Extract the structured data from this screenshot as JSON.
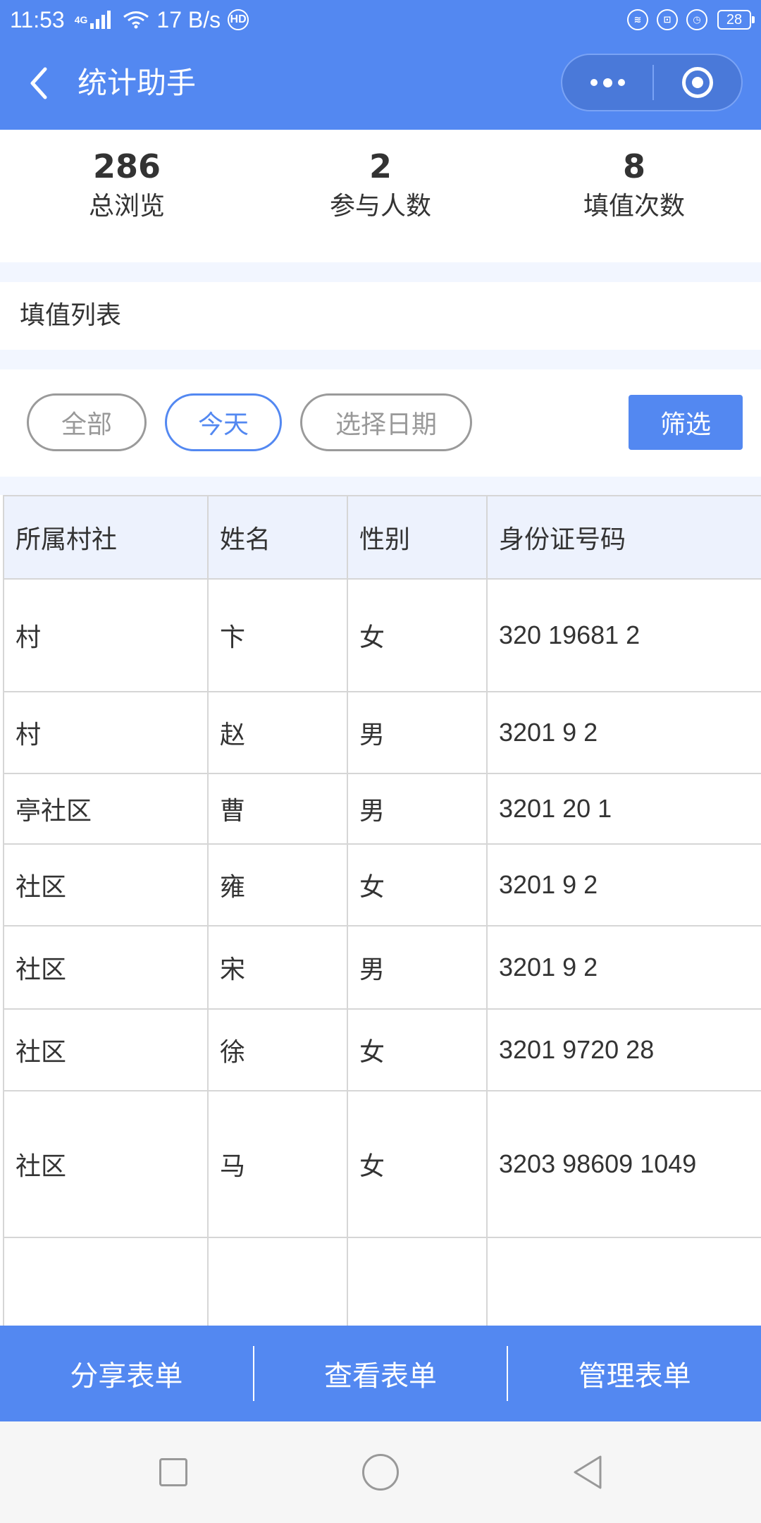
{
  "status_bar": {
    "time": "11:53",
    "net_top": "4G",
    "net_bottom": "ıl",
    "speed": "17 B/s",
    "hd": "HD",
    "battery": "28"
  },
  "nav": {
    "title": "统计助手"
  },
  "stats": [
    {
      "value": "286",
      "label": "总浏览"
    },
    {
      "value": "2",
      "label": "参与人数"
    },
    {
      "value": "8",
      "label": "填值次数"
    }
  ],
  "section": {
    "title": "填值列表"
  },
  "filters": {
    "all": "全部",
    "today": "今天",
    "pick_date": "选择日期",
    "filter_button": "筛选",
    "active": "today"
  },
  "table": {
    "headers": [
      "所属村社",
      "姓名",
      "性别",
      "身份证号码"
    ],
    "rows": [
      {
        "village": "村",
        "name": "卞",
        "gender": "女",
        "id": "320 19681 2"
      },
      {
        "village": "村",
        "name": "赵",
        "gender": "男",
        "id": "3201 9 2"
      },
      {
        "village": "亭社区",
        "name": "曹",
        "gender": "男",
        "id": "3201 20 1"
      },
      {
        "village": "社区",
        "name": "雍",
        "gender": "女",
        "id": "3201 9 2"
      },
      {
        "village": "社区",
        "name": "宋",
        "gender": "男",
        "id": "3201 9 2"
      },
      {
        "village": "社区",
        "name": "徐",
        "gender": "女",
        "id": "3201 9720 28"
      },
      {
        "village": "社区",
        "name": "马",
        "gender": "女",
        "id": "3203 98609 1049"
      }
    ]
  },
  "actions": [
    "分享表单",
    "查看表单",
    "管理表单"
  ],
  "colors": {
    "primary": "#5388f1",
    "page_bg": "#f2f6ff",
    "header_bg": "#edf2fd"
  }
}
